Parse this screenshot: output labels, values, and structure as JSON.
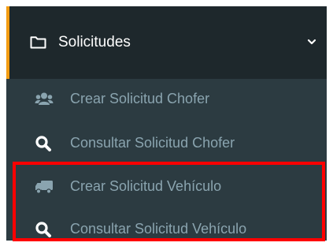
{
  "menu": {
    "title": "Solicitudes",
    "items": [
      {
        "label": "Crear Solicitud Chofer",
        "icon": "users-icon"
      },
      {
        "label": "Consultar Solicitud Chofer",
        "icon": "search-icon"
      },
      {
        "label": "Crear Solicitud Vehículo",
        "icon": "truck-icon"
      },
      {
        "label": "Consultar Solicitud Vehículo",
        "icon": "search-icon"
      }
    ]
  },
  "colors": {
    "sidebar_background": "#2c3b41",
    "header_background": "#1e282c",
    "accent": "#f39c12",
    "item_text": "#8aa4af",
    "highlight": "#ff0000"
  }
}
